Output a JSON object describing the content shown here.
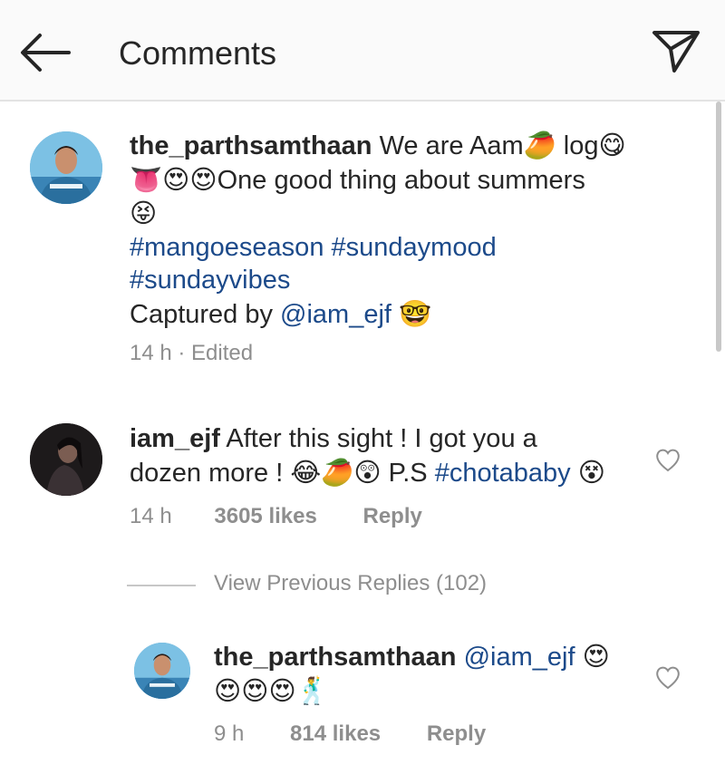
{
  "header": {
    "title": "Comments",
    "back_icon": "arrow-left-icon",
    "send_icon": "paper-plane-icon"
  },
  "caption": {
    "username": "the_parthsamthaan",
    "text_part1": " We are Aam",
    "text_part2": " log",
    "line2": "One good thing about summers",
    "hashtag1": "#mangoeseason",
    "hashtag2": "#sundaymood",
    "hashtag3": "#sundayvibes",
    "captured_prefix": "Captured by ",
    "mention": "@iam_ejf",
    "time": "14 h",
    "edited": "Edited"
  },
  "comment": {
    "username": "iam_ejf",
    "text1": " After this sight ! I got you a",
    "text2": "dozen more ! ",
    "ps": " P.S ",
    "hashtag": "#chotababy",
    "time": "14 h",
    "likes": "3605 likes",
    "reply": "Reply"
  },
  "view_previous": "View Previous Replies (102)",
  "reply": {
    "username": "the_parthsamthaan",
    "mention": "@iam_ejf",
    "time": "9 h",
    "likes": "814 likes",
    "reply": "Reply"
  },
  "colors": {
    "link": "#1c4a8a",
    "meta": "#8e8e8e",
    "header_bg": "#fafafa"
  }
}
